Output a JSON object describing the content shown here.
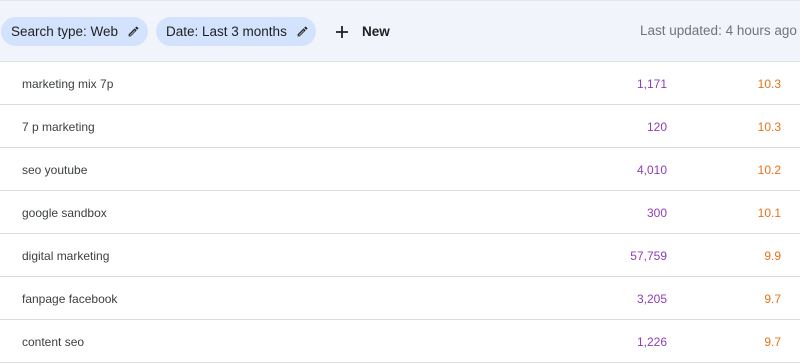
{
  "filters": {
    "search_type_label": "Search type: Web",
    "date_label": "Date: Last 3 months",
    "new_label": "New",
    "last_updated": "Last updated: 4 hours ago"
  },
  "icons": {
    "edit": "pencil-icon",
    "add": "plus-icon"
  },
  "colors": {
    "chip_bg": "#d3e3fd",
    "clicks": "#8e3fb6",
    "position": "#e8711a"
  },
  "table": {
    "rows": [
      {
        "query": "marketing mix 7p",
        "clicks": "1,171",
        "position": "10.3"
      },
      {
        "query": "7 p marketing",
        "clicks": "120",
        "position": "10.3"
      },
      {
        "query": "seo youtube",
        "clicks": "4,010",
        "position": "10.2"
      },
      {
        "query": "google sandbox",
        "clicks": "300",
        "position": "10.1"
      },
      {
        "query": "digital marketing",
        "clicks": "57,759",
        "position": "9.9"
      },
      {
        "query": "fanpage facebook",
        "clicks": "3,205",
        "position": "9.7"
      },
      {
        "query": "content seo",
        "clicks": "1,226",
        "position": "9.7"
      }
    ]
  }
}
